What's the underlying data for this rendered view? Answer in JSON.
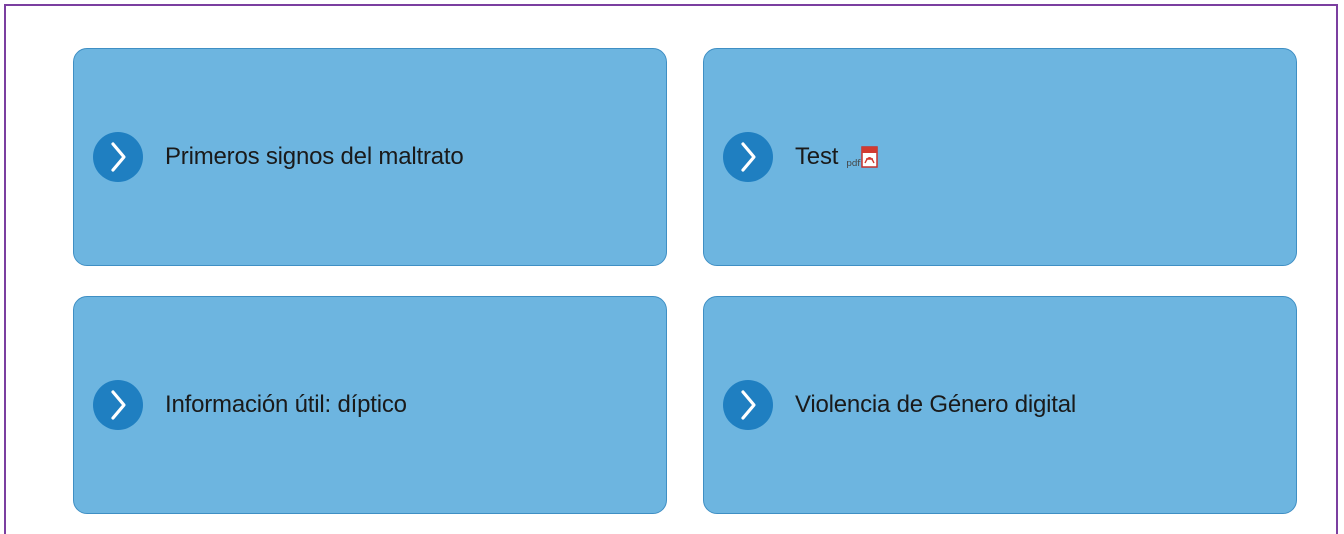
{
  "cards": [
    {
      "label": "Primeros signos del maltrato",
      "icon": "chevron-right-icon"
    },
    {
      "label": "Test",
      "icon": "chevron-right-icon",
      "badge": {
        "text": "pdf",
        "icon": "pdf-file-icon"
      }
    },
    {
      "label": "Información útil: díptico",
      "icon": "chevron-right-icon"
    },
    {
      "label": "Violencia de Género digital",
      "icon": "chevron-right-icon"
    }
  ],
  "colors": {
    "card_background": "#6db5e0",
    "card_border": "#3f8fc4",
    "arrow_circle": "#1f7fc1",
    "frame_border": "#7b3fa0"
  }
}
